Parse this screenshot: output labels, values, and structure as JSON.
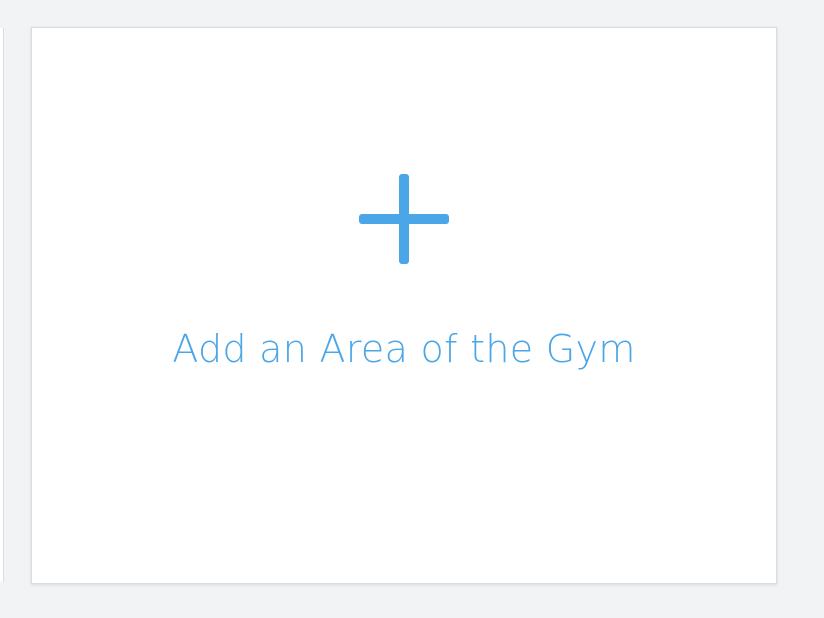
{
  "card": {
    "label": "Add an Area of the Gym",
    "icon": "plus-icon"
  },
  "colors": {
    "accent": "#4aa6e6",
    "background": "#f2f3f5",
    "card": "#ffffff"
  }
}
